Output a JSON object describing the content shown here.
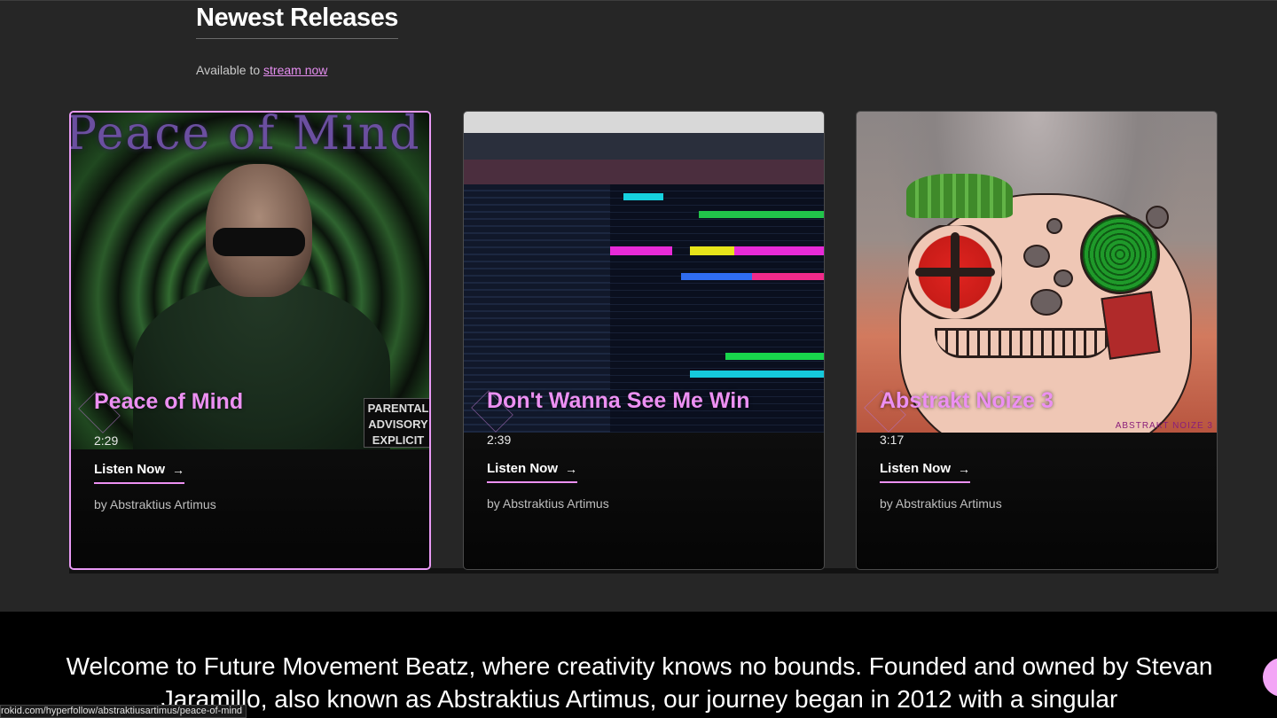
{
  "section": {
    "title": "Newest Releases",
    "subtitle_prefix": "Available to ",
    "subtitle_link": "stream now"
  },
  "releases": [
    {
      "title": "Peace of Mind",
      "duration": "2:29",
      "cta": "Listen Now",
      "artist": "by Abstraktius Artimus",
      "art_text": "Peace of Mind",
      "advisory": "PARENTAL ADVISORY EXPLICIT CONTENT",
      "active": true
    },
    {
      "title": "Don't Wanna See Me Win",
      "duration": "2:39",
      "cta": "Listen Now",
      "artist": "by Abstraktius Artimus",
      "active": false
    },
    {
      "title": "Abstrakt Noize 3",
      "duration": "3:17",
      "cta": "Listen Now",
      "artist": "by Abstraktius Artimus",
      "art_text": "ABSTRAKT NOIZE 3",
      "active": false
    }
  ],
  "welcome": {
    "text": "Welcome to Future Movement Beatz, where creativity knows no bounds. Founded and owned by Stevan Jaramillo, also known as Abstraktius Artimus, our journey began in 2012 with a singular"
  },
  "status_bar": {
    "url": "rokid.com/hyperfollow/abstraktiusartimus/peace-of-mind"
  },
  "colors": {
    "accent": "#ec90f2",
    "background": "#262626",
    "welcome_bg": "#000000"
  },
  "icons": {
    "listen_arrow": "arrow-right-icon"
  }
}
